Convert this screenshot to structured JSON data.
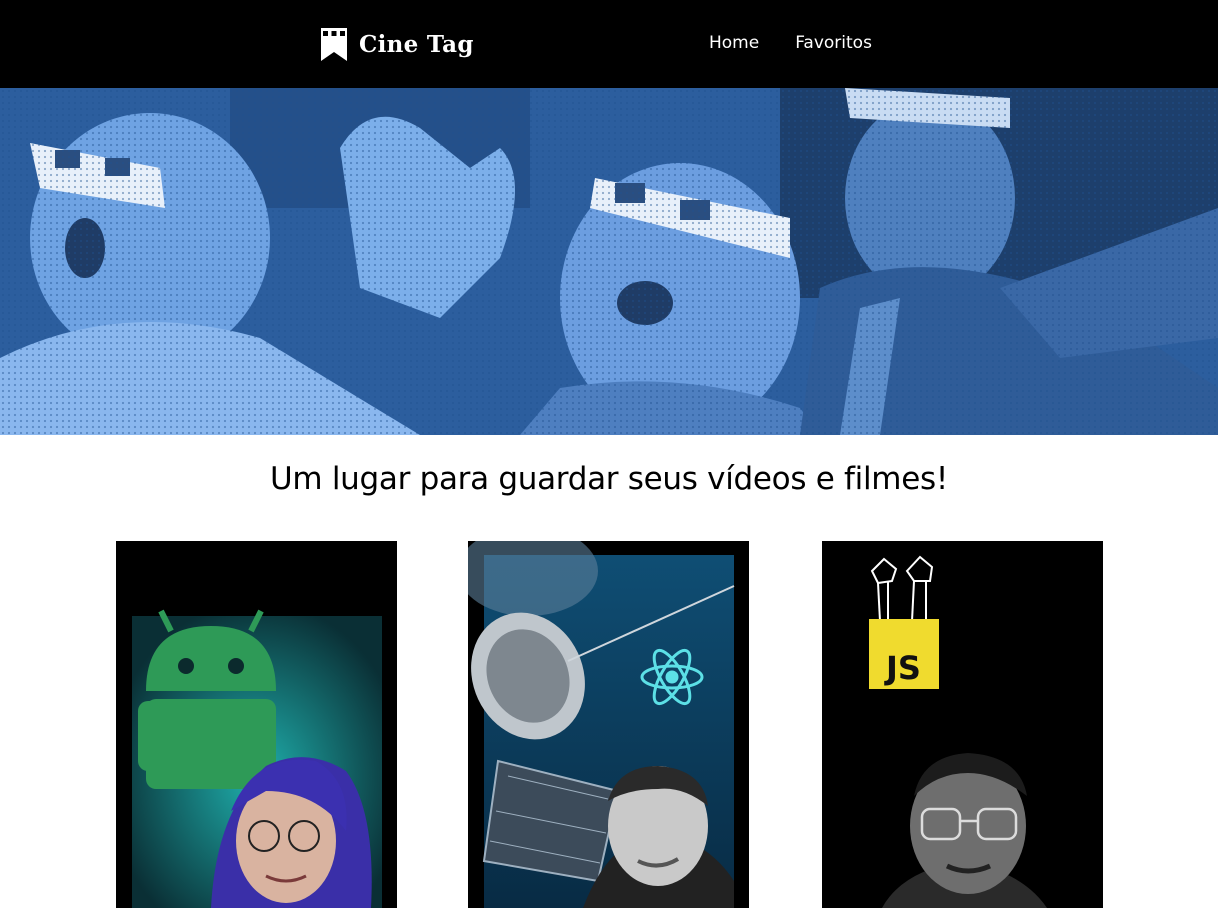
{
  "header": {
    "logo_text": "Cine Tag",
    "nav": [
      {
        "label": "Home"
      },
      {
        "label": "Favoritos"
      }
    ]
  },
  "banner": {
    "image": "people-watching-3d-movie-photo",
    "tint_color": "#3f82d3"
  },
  "main": {
    "title": "Um lugar para guardar seus vídeos e filmes!"
  },
  "cards": [
    {
      "thumbnail": "android-thumbnail",
      "badge_icon": "android-robot-icon",
      "background": "#0f4a4a"
    },
    {
      "thumbnail": "react-thumbnail",
      "badge_icon": "react-atom-icon",
      "background": "#0d3a55"
    },
    {
      "thumbnail": "javascript-thumbnail",
      "badge_icon": "js-logo-icon",
      "badge_text": "JS",
      "badge_color": "#f0db2e"
    }
  ]
}
